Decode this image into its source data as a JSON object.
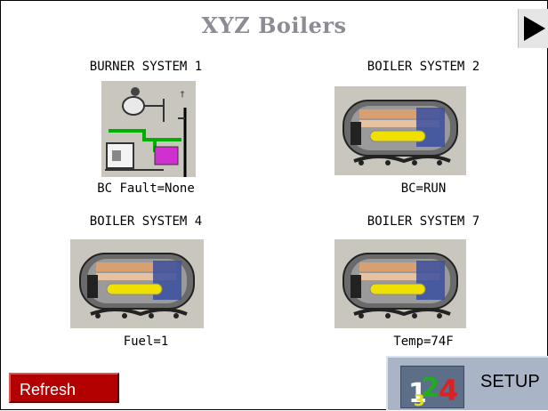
{
  "header": {
    "title": "XYZ Boilers",
    "next_icon": "play-arrow-icon"
  },
  "panels": [
    {
      "label": "BURNER SYSTEM 1",
      "status": "BC Fault=None",
      "image": "burner-schematic"
    },
    {
      "label": "BOILER SYSTEM 2",
      "status": "BC=RUN",
      "image": "boiler-cutaway"
    },
    {
      "label": "BOILER SYSTEM 4",
      "status": "Fuel=1",
      "image": "boiler-cutaway"
    },
    {
      "label": "BOILER SYSTEM 7",
      "status": "Temp=74F",
      "image": "boiler-cutaway"
    }
  ],
  "footer": {
    "refresh_label": "Refresh",
    "setup_label": "SETUP",
    "setup_icon": "numbers-123-icon",
    "setup_icon_digits": [
      "1",
      "2",
      "3",
      "4"
    ]
  },
  "colors": {
    "title": "#8c8c96",
    "refresh_bg": "#b30000",
    "setup_bg": "#a9b4c7",
    "image_bg": "#c9c7bd"
  }
}
